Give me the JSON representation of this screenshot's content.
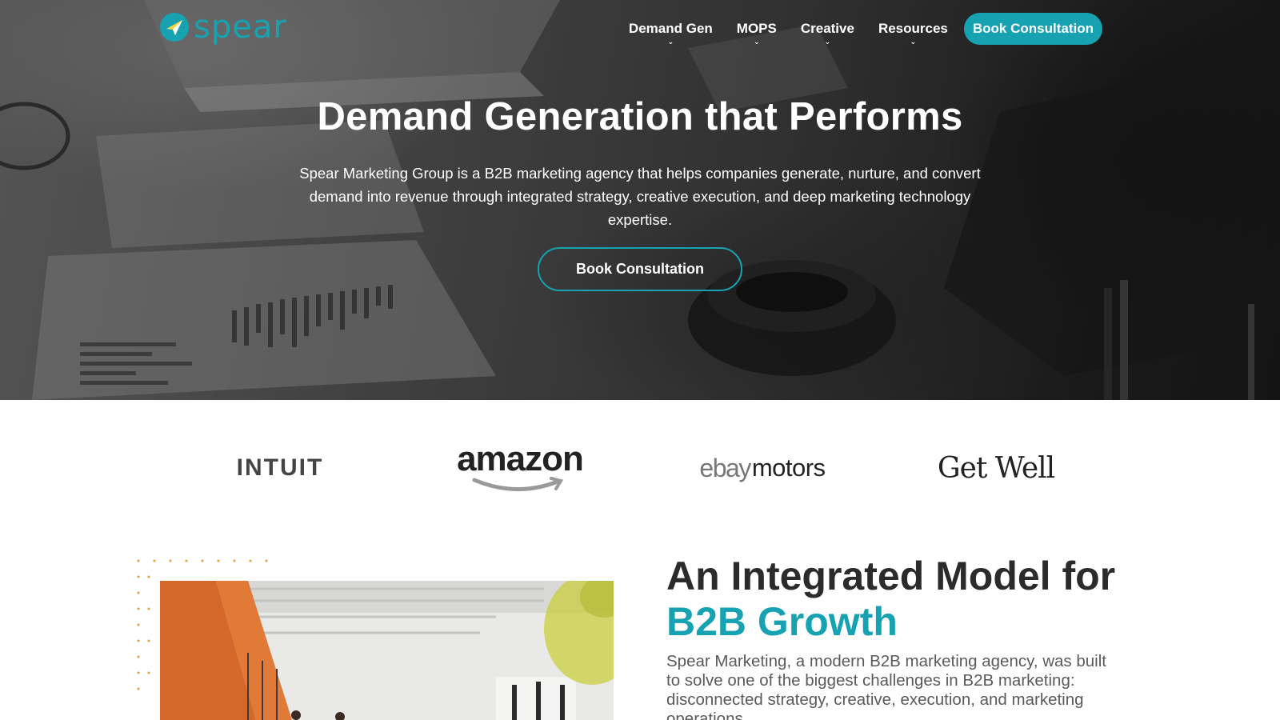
{
  "brand": {
    "name": "spear",
    "color": "#16a2b1"
  },
  "nav": {
    "items": [
      {
        "label": "Demand Gen",
        "has_dropdown": true
      },
      {
        "label": "MOPS",
        "has_dropdown": true
      },
      {
        "label": "Creative",
        "has_dropdown": true
      },
      {
        "label": "Resources",
        "has_dropdown": true
      }
    ],
    "cta_label": "Book Consultation"
  },
  "hero": {
    "title": "Demand Generation that Performs",
    "subtitle": "Spear Marketing Group is a B2B marketing agency that helps companies generate, nurture, and convert demand into revenue through integrated strategy, creative execution, and deep marketing technology expertise.",
    "cta_label": "Book Consultation"
  },
  "clients": {
    "intuit": "INTUIT",
    "amazon": "amazon",
    "ebay_prefix": "ebay",
    "ebay_suffix": "motors",
    "getwell": "Get Well"
  },
  "section": {
    "title_plain": "An Integrated Model for ",
    "title_accent": "B2B Growth",
    "text": "Spear Marketing, a modern B2B marketing agency, was built to solve one of the biggest challenges in B2B marketing: disconnected strategy, creative, execution, and marketing operations."
  },
  "colors": {
    "accent": "#16a2b1",
    "heading": "#2b2b2b",
    "body_text": "#5a5a5a"
  }
}
